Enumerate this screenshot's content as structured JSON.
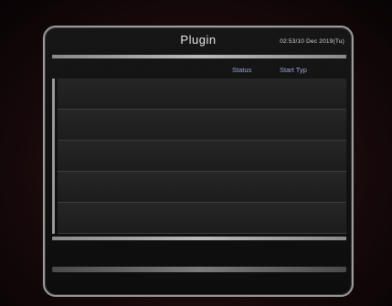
{
  "window": {
    "title": "Plugin",
    "clock": "02:53/10 Dec 2019(Tu)"
  },
  "table": {
    "columns": [
      "",
      "Status",
      "Start Typ"
    ],
    "rows": [
      {
        "name": "",
        "status": "",
        "type": ""
      },
      {
        "name": "",
        "status": "",
        "type": ""
      },
      {
        "name": "",
        "status": "",
        "type": ""
      },
      {
        "name": "",
        "status": "",
        "type": ""
      },
      {
        "name": "",
        "status": "",
        "type": ""
      }
    ]
  },
  "colors": {
    "header_text": "#9aa6d6",
    "accent_bar": "#b9b9b9"
  }
}
